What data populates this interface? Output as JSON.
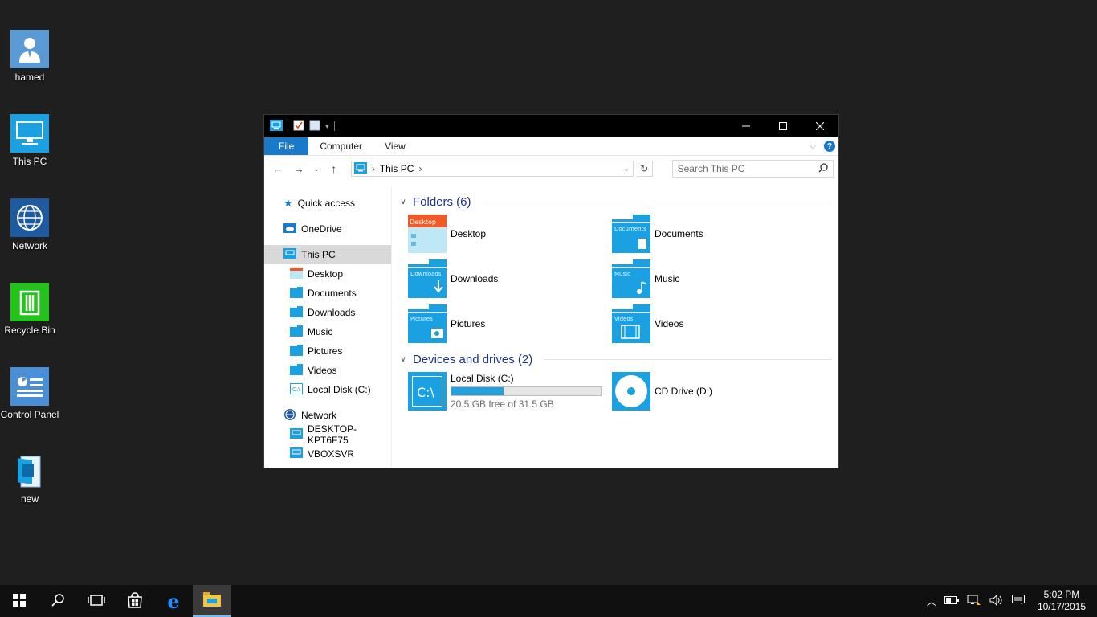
{
  "desktop": {
    "icons": [
      {
        "label": "hamed",
        "icon": "user-icon"
      },
      {
        "label": "This PC",
        "icon": "computer-icon"
      },
      {
        "label": "Network",
        "icon": "network-icon"
      },
      {
        "label": "Recycle Bin",
        "icon": "recycle-bin-icon"
      },
      {
        "label": "Control Panel",
        "icon": "control-panel-icon"
      },
      {
        "label": "new",
        "icon": "document-icon"
      }
    ]
  },
  "window": {
    "ribbon": {
      "tabs": [
        "File",
        "Computer",
        "View"
      ]
    },
    "address": {
      "location": "This PC"
    },
    "search": {
      "placeholder": "Search This PC"
    },
    "nav": {
      "quick_access": "Quick access",
      "onedrive": "OneDrive",
      "this_pc": "This PC",
      "this_pc_children": [
        "Desktop",
        "Documents",
        "Downloads",
        "Music",
        "Pictures",
        "Videos",
        "Local Disk (C:)"
      ],
      "network": "Network",
      "network_children": [
        "DESKTOP-KPT6F75",
        "VBOXSVR"
      ]
    },
    "folders_header": "Folders (6)",
    "folders": [
      {
        "name": "Desktop",
        "icon_text": "Desktop"
      },
      {
        "name": "Documents",
        "icon_text": "Documents"
      },
      {
        "name": "Downloads",
        "icon_text": "Downloads"
      },
      {
        "name": "Music",
        "icon_text": "Music"
      },
      {
        "name": "Pictures",
        "icon_text": "Pictures"
      },
      {
        "name": "Videos",
        "icon_text": "Videos"
      }
    ],
    "drives_header": "Devices and drives (2)",
    "drives": {
      "local": {
        "name": "Local Disk (C:)",
        "icon_text": "C:\\",
        "free_text": "20.5 GB free of 31.5 GB",
        "used_fraction": 0.35
      },
      "cd": {
        "name": "CD Drive (D:)"
      }
    }
  },
  "taskbar": {
    "time": "5:02 PM",
    "date": "10/17/2015"
  },
  "colors": {
    "accent": "#1979ca",
    "folder": "#1ba1e2",
    "desktop_bg": "#1f1f1f",
    "recycle": "#22c31a"
  }
}
